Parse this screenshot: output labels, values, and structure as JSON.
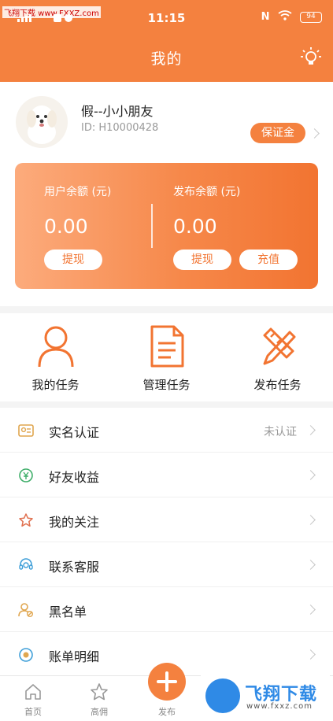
{
  "status_bar": {
    "watermark": "飞翔下载 www.FXXZ.com",
    "time": "11:15",
    "network": "N",
    "battery": "94"
  },
  "nav": {
    "title": "我的",
    "icon": "lightbulb-icon"
  },
  "profile": {
    "nickname": "假--小小朋友",
    "user_id": "ID: H10000428",
    "deposit_label": "保证金"
  },
  "wallet": {
    "user_balance_label": "用户余额 (元)",
    "user_balance": "0.00",
    "publish_balance_label": "发布余额 (元)",
    "publish_balance": "0.00",
    "withdraw_label": "提现",
    "recharge_label": "充值"
  },
  "tasks": [
    {
      "label": "我的任务",
      "icon": "person-icon"
    },
    {
      "label": "管理任务",
      "icon": "document-icon"
    },
    {
      "label": "发布任务",
      "icon": "pencil-ruler-icon"
    }
  ],
  "menu": [
    {
      "label": "实名认证",
      "value": "未认证",
      "icon": "id-card-icon"
    },
    {
      "label": "好友收益",
      "value": "",
      "icon": "money-icon"
    },
    {
      "label": "我的关注",
      "value": "",
      "icon": "star-icon"
    },
    {
      "label": "联系客服",
      "value": "",
      "icon": "headset-icon"
    },
    {
      "label": "黑名单",
      "value": "",
      "icon": "blacklist-user-icon"
    },
    {
      "label": "账单明细",
      "value": "",
      "icon": "bill-icon"
    }
  ],
  "tabbar": [
    {
      "label": "首页",
      "icon": "home-icon"
    },
    {
      "label": "高佣",
      "icon": "star-icon"
    },
    {
      "label": "发布",
      "icon": "plus-icon"
    }
  ],
  "watermark_logo": {
    "title": "飞翔下载",
    "subtitle": "www.fxxz.com"
  },
  "colors": {
    "accent": "#f4813f",
    "background": "#f4f4f4"
  }
}
